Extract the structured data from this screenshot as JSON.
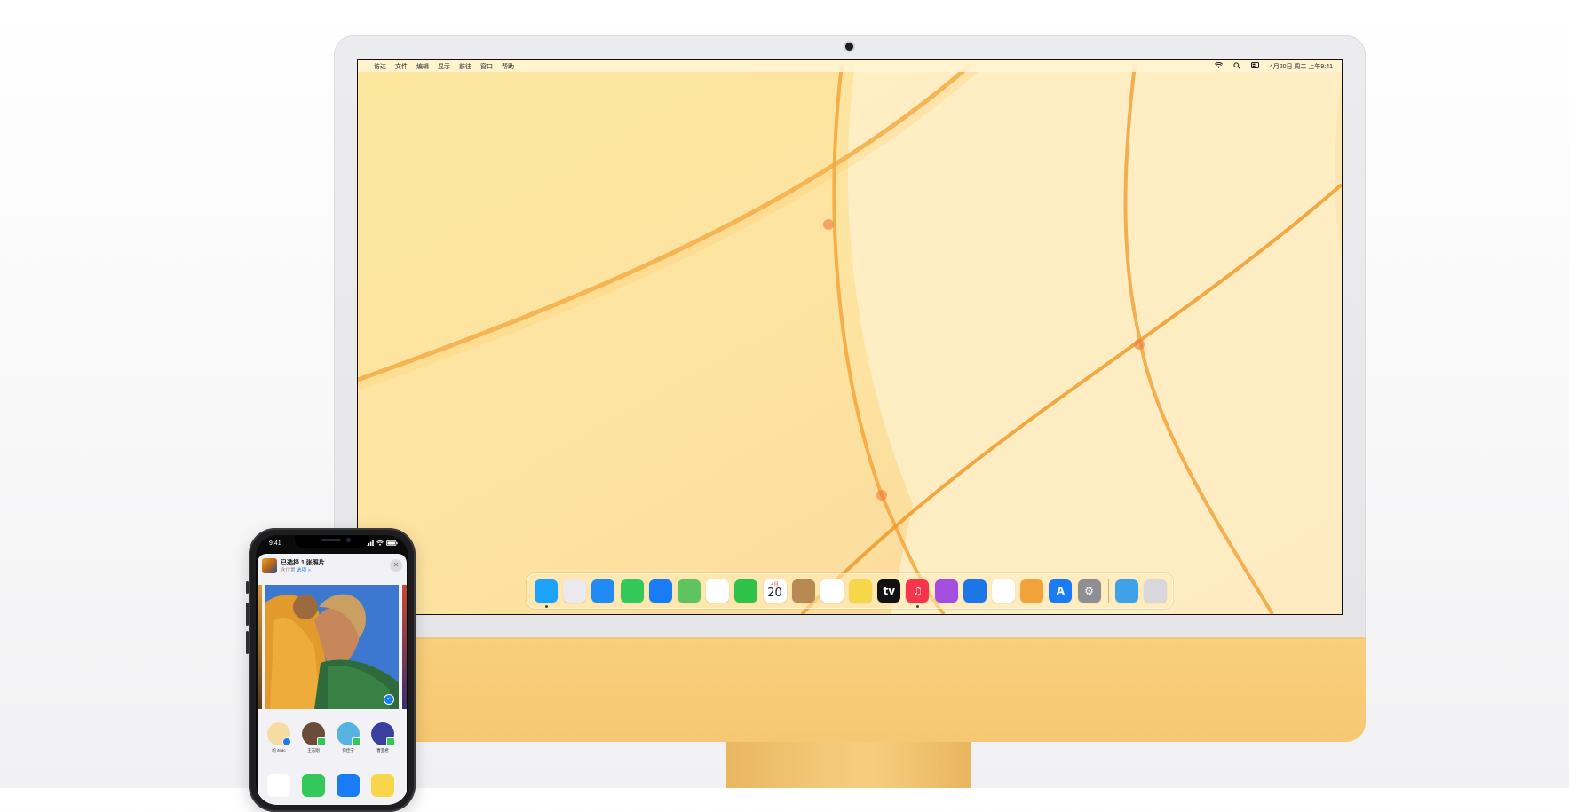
{
  "menubar": {
    "items": [
      "访达",
      "文件",
      "编辑",
      "显示",
      "前往",
      "窗口",
      "帮助"
    ],
    "clock": "4月20日 周二 上午9:41"
  },
  "dock": {
    "apps": [
      {
        "name": "finder-icon",
        "label": "",
        "color": "#1ca2f8"
      },
      {
        "name": "launchpad-icon",
        "label": "",
        "color": "#e9e9ee"
      },
      {
        "name": "safari-icon",
        "label": "",
        "color": "#1f8bf3"
      },
      {
        "name": "messages-icon",
        "label": "",
        "color": "#34c759"
      },
      {
        "name": "mail-icon",
        "label": "",
        "color": "#1a7cf5"
      },
      {
        "name": "maps-icon",
        "label": "",
        "color": "#5ec45f"
      },
      {
        "name": "photos-icon",
        "label": "",
        "color": "#ffffff"
      },
      {
        "name": "facetime-icon",
        "label": "",
        "color": "#2fc248"
      },
      {
        "name": "calendar-icon",
        "label": "20",
        "month": "4月",
        "color": "#ffffff"
      },
      {
        "name": "contacts-icon",
        "label": "",
        "color": "#b98953"
      },
      {
        "name": "reminders-icon",
        "label": "",
        "color": "#ffffff"
      },
      {
        "name": "notes-icon",
        "label": "",
        "color": "#f8d649"
      },
      {
        "name": "appletv-icon",
        "label": "tv",
        "color": "#111111"
      },
      {
        "name": "music-icon",
        "label": "♫",
        "color": "#f8344d"
      },
      {
        "name": "podcasts-icon",
        "label": "",
        "color": "#a44ee0"
      },
      {
        "name": "keynote-icon",
        "label": "",
        "color": "#1c76e8"
      },
      {
        "name": "numbers-icon",
        "label": "",
        "color": "#ffffff"
      },
      {
        "name": "pages-icon",
        "label": "",
        "color": "#f1a23a"
      },
      {
        "name": "appstore-icon",
        "label": "A",
        "color": "#1a7cf5"
      },
      {
        "name": "system-preferences-icon",
        "label": "⚙",
        "color": "#8e8e93"
      }
    ],
    "folder": {
      "name": "downloads-folder-icon",
      "color": "#3fa1e8"
    },
    "trash": {
      "name": "trash-icon",
      "color": "#d8d8dc"
    }
  },
  "iphone": {
    "time": "9:41",
    "sheet": {
      "title": "已选择 1 张照片",
      "subtitle": "含位置",
      "options_label": "选项 >",
      "close": "✕"
    },
    "people": [
      {
        "name": "的 iMac",
        "color": "#f4dca3",
        "badge": "blue"
      },
      {
        "name": "王志刚",
        "color": "#6b4c3b",
        "badge": "green"
      },
      {
        "name": "何佳宁",
        "color": "#56b2e0",
        "badge": "green"
      },
      {
        "name": "曹亚君",
        "color": "#3a3f9e",
        "badge": "green"
      }
    ],
    "apps": [
      {
        "name": "airdrop-icon",
        "color": "#ffffff"
      },
      {
        "name": "messages-app-icon",
        "color": "#34c759"
      },
      {
        "name": "mail-app-icon",
        "color": "#1a7cf5"
      },
      {
        "name": "notes-app-icon",
        "color": "#f8d649"
      }
    ]
  }
}
